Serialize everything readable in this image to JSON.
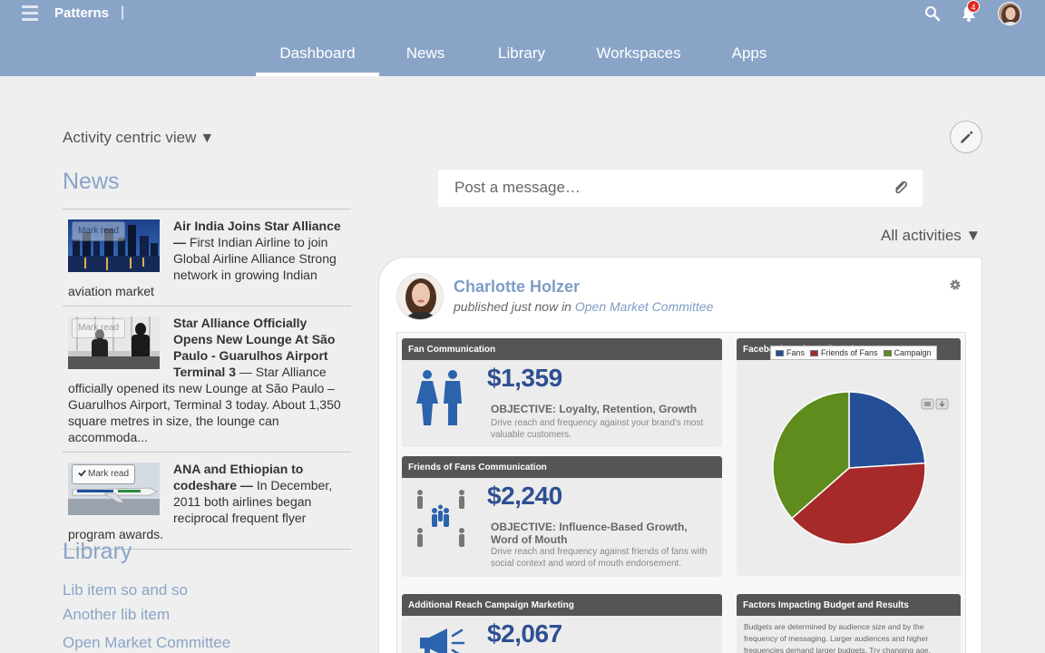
{
  "app": {
    "brand": "Patterns",
    "brand_separator": "|",
    "notification_count": "4"
  },
  "tabs": [
    {
      "label": "Dashboard",
      "active": true
    },
    {
      "label": "News",
      "active": false
    },
    {
      "label": "Library",
      "active": false
    },
    {
      "label": "Workspaces",
      "active": false
    },
    {
      "label": "Apps",
      "active": false
    }
  ],
  "left": {
    "view_label": "Activity centric view",
    "view_arrow": "▼",
    "news_heading": "News",
    "news": [
      {
        "mark_label": "Mark read",
        "title": "Air India Joins Star Alliance —",
        "body": " First Indian Airline to join Global Airline Alliance Strong network in growing Indian aviation market"
      },
      {
        "mark_label": "Mark read",
        "title": "Star Alliance Officially Opens New Lounge At São Paulo - Guarulhos Airport Terminal 3",
        "body": " — Star Alliance officially opened its new Lounge at São Paulo –Guarulhos Airport, Terminal 3 today. About 1,350 square metres in size, the lounge can accommoda..."
      },
      {
        "mark_label": "Mark read",
        "title": "ANA and Ethiopian to codeshare —",
        "body": " In December, 2011 both airlines began reciprocal frequent flyer program awards."
      }
    ],
    "library_heading": "Library",
    "library_items": [
      "Lib item so and so",
      "Another lib item",
      "Open Market Committee"
    ]
  },
  "main": {
    "post_placeholder": "Post a message…",
    "filter_label": "All activities",
    "filter_arrow": "▼",
    "post": {
      "author": "Charlotte Holzer",
      "meta_prefix": "published just now in ",
      "meta_link": "Open Market Committee"
    },
    "infographic": {
      "panels": [
        {
          "title": "Fan Communication",
          "amount": "$1,359",
          "objective": "OBJECTIVE: Loyalty, Retention, Growth",
          "desc": "Drive reach and frequency against your brand's most valuable customers."
        },
        {
          "title": "Friends of Fans Communication",
          "amount": "$2,240",
          "objective": "OBJECTIVE: Influence-Based Growth, Word of Mouth",
          "desc": "Drive reach and frequency against friends of fans with social context and word of mouth endorsement."
        },
        {
          "title": "Additional Reach Campaign Marketing",
          "amount": "$2,067"
        }
      ],
      "budget_title": "Facebook Budget Allocation, 2013",
      "factors_title": "Factors Impacting Budget and Results",
      "factors_text": "Budgets are determined by audience size and by the frequency of messaging. Larger audiences and higher frequencies demand larger budgets. Try changing age, geography, interests"
    }
  },
  "chart_data": {
    "type": "pie",
    "title": "Facebook Budget Allocation, 2013",
    "legend": [
      "Fans",
      "Friends of Fans",
      "Campaign"
    ],
    "legend_position": "top",
    "values": [
      1359,
      2240,
      2067
    ],
    "colors": [
      "#244f96",
      "#a62a2a",
      "#5e8c1d"
    ]
  }
}
